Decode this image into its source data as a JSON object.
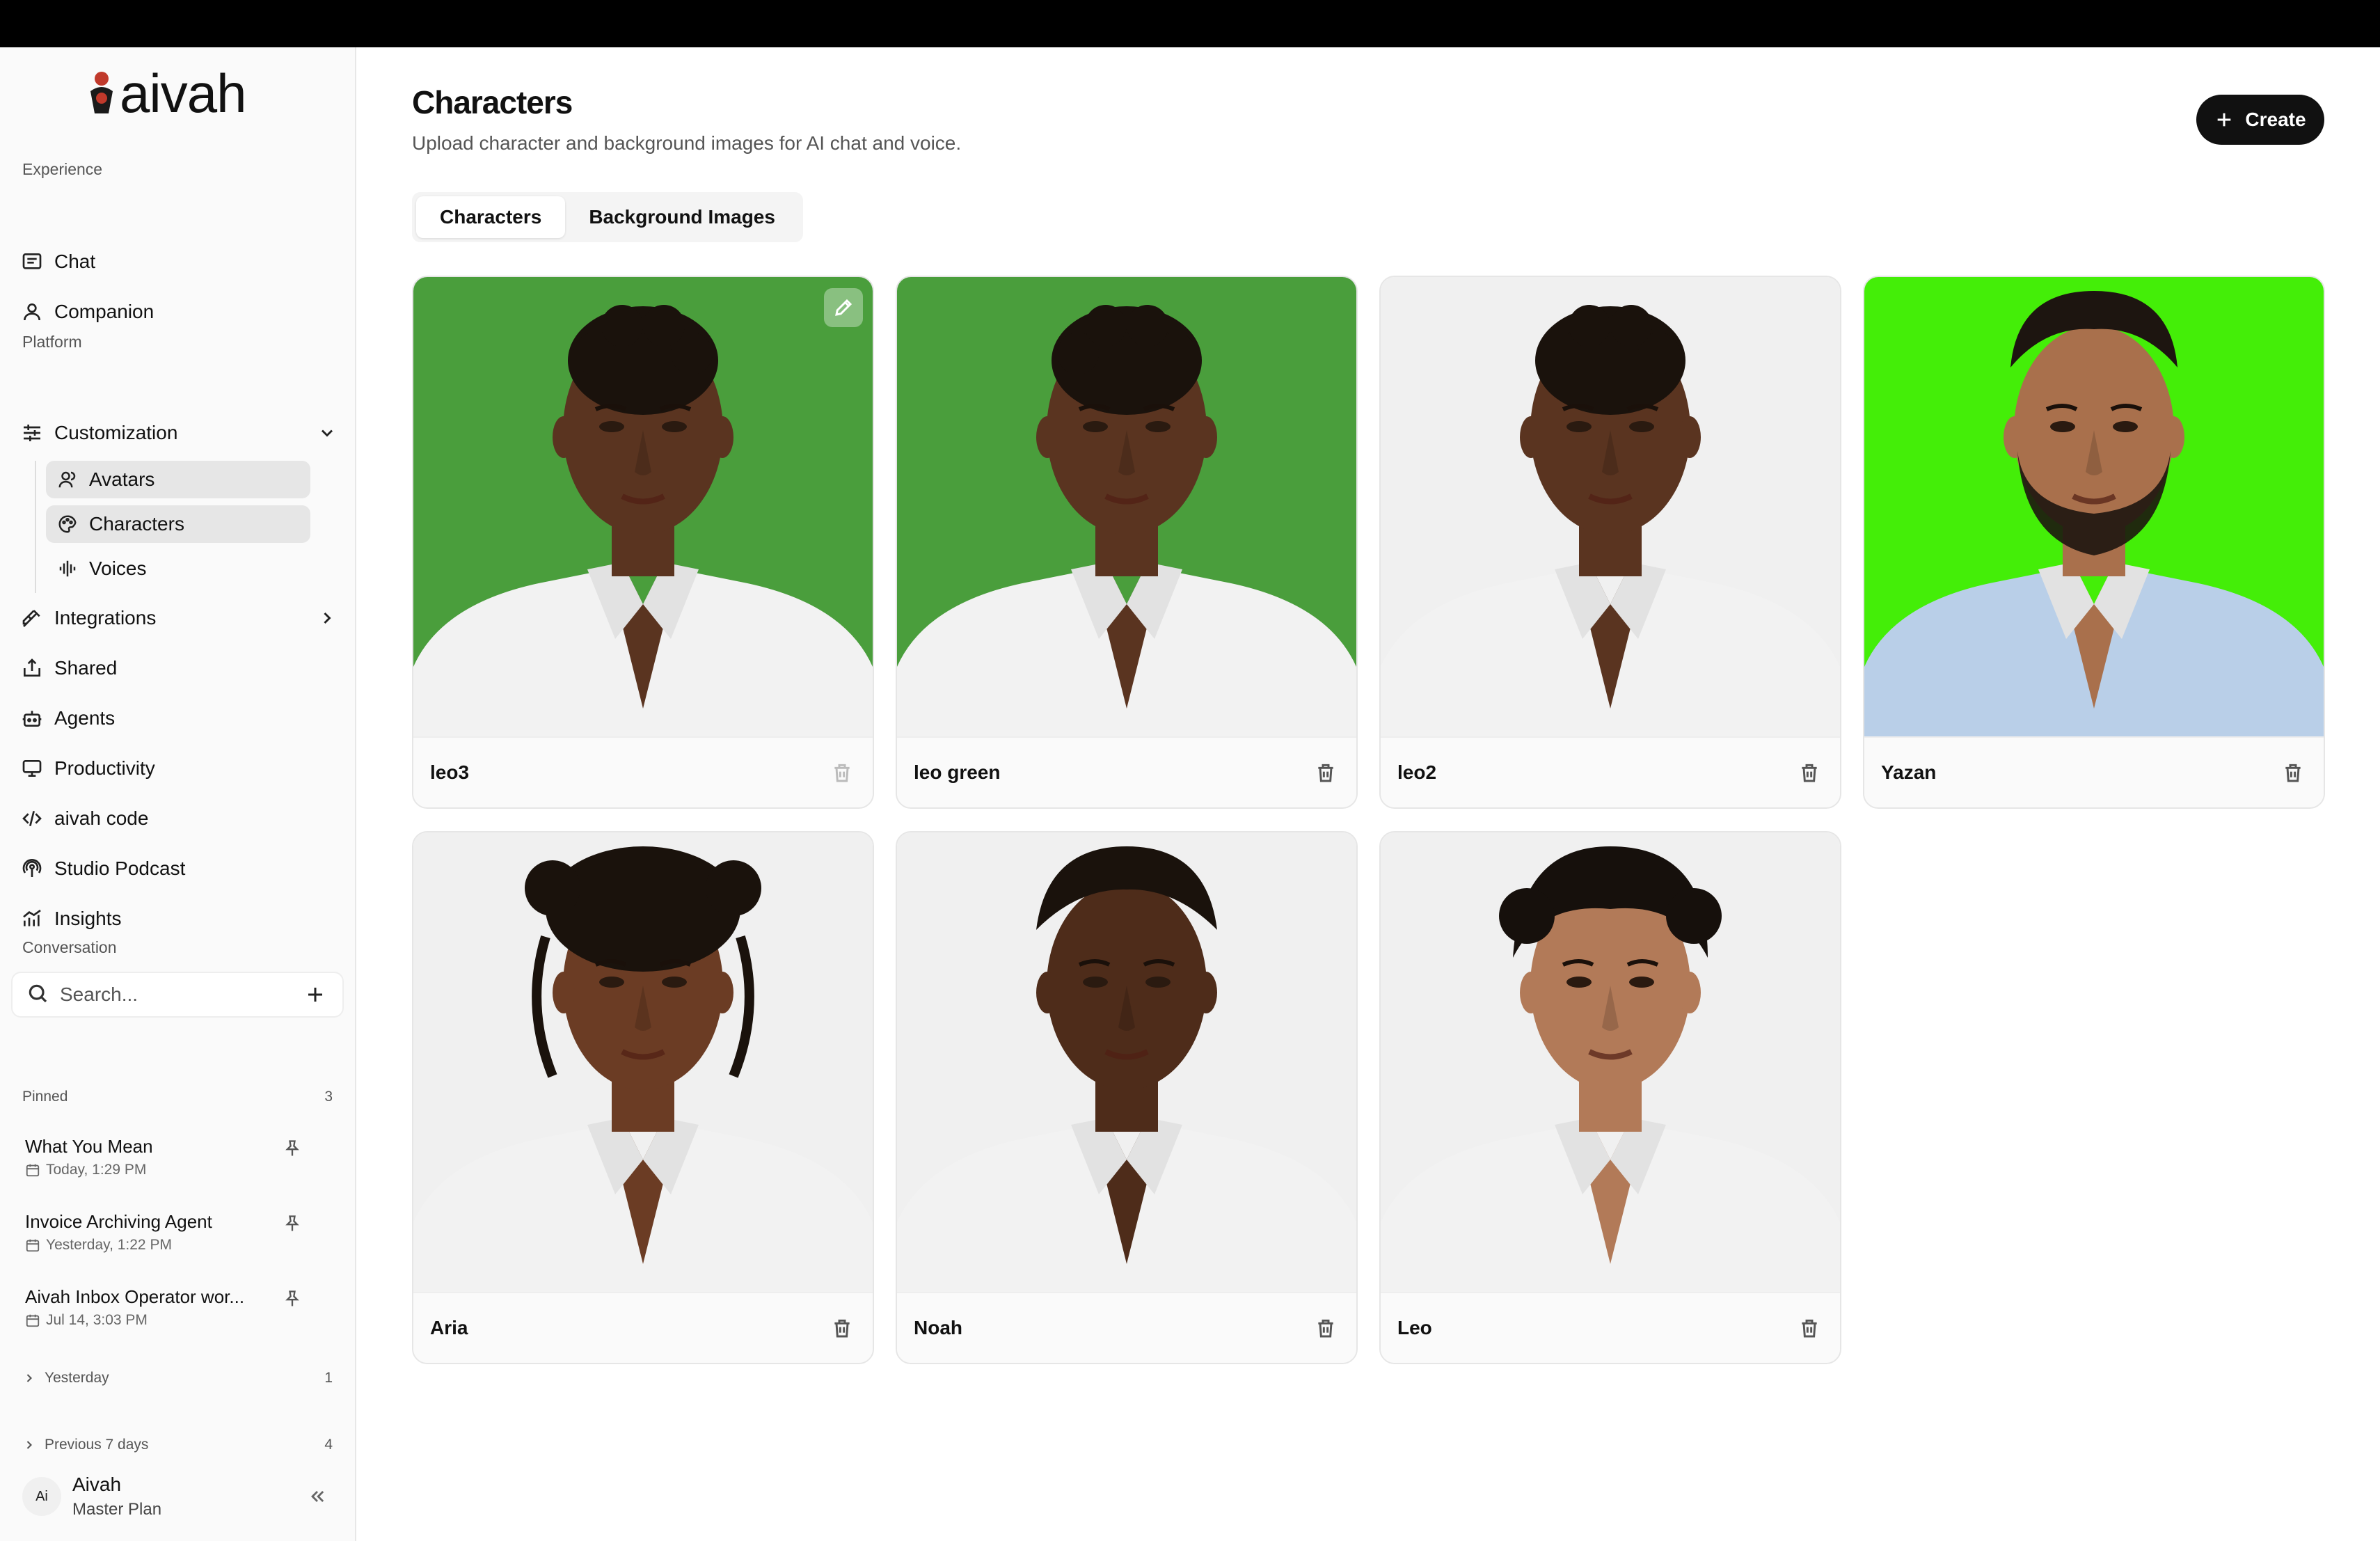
{
  "app": {
    "logo_text": "aivah"
  },
  "sidebar": {
    "experience_label": "Experience",
    "experience_items": [
      {
        "label": "Chat",
        "icon": "chat-icon"
      },
      {
        "label": "Companion",
        "icon": "user-icon"
      }
    ],
    "platform_label": "Platform",
    "customization": {
      "label": "Customization",
      "icon": "sliders-icon",
      "expanded": true
    },
    "customization_sub": [
      {
        "label": "Avatars",
        "icon": "user-icon",
        "active": true
      },
      {
        "label": "Characters",
        "icon": "palette-icon",
        "active": true
      },
      {
        "label": "Voices",
        "icon": "waveform-icon",
        "active": false
      }
    ],
    "platform_items": [
      {
        "label": "Integrations",
        "icon": "plug-icon",
        "has_chevron": true
      },
      {
        "label": "Shared",
        "icon": "share-icon"
      },
      {
        "label": "Agents",
        "icon": "bot-icon"
      },
      {
        "label": "Productivity",
        "icon": "monitor-icon"
      },
      {
        "label": "aivah code",
        "icon": "code-icon"
      },
      {
        "label": "Studio Podcast",
        "icon": "podcast-icon"
      },
      {
        "label": "Insights",
        "icon": "chart-icon"
      }
    ],
    "conversation_label": "Conversation",
    "search_placeholder": "Search...",
    "pinned_label": "Pinned",
    "pinned_count": "3",
    "pinned": [
      {
        "title": "What You Mean",
        "time": "Today, 1:29 PM"
      },
      {
        "title": "Invoice Archiving Agent",
        "time": "Yesterday, 1:22 PM"
      },
      {
        "title": "Aivah Inbox Operator wor...",
        "time": "Jul 14, 3:03 PM"
      }
    ],
    "groups": [
      {
        "label": "Yesterday",
        "count": "1"
      },
      {
        "label": "Previous 7 days",
        "count": "4"
      }
    ],
    "user": {
      "initials": "Ai",
      "name": "Aivah",
      "plan": "Master Plan"
    }
  },
  "main": {
    "title": "Characters",
    "subtitle": "Upload character and background images for AI chat and voice.",
    "create_label": "Create",
    "tabs": [
      {
        "label": "Characters",
        "active": true
      },
      {
        "label": "Background Images",
        "active": false
      }
    ],
    "characters": [
      {
        "name": "leo3",
        "bg": "#4a9e3c",
        "skin": "#5a3420",
        "hair": "#1a120c",
        "shirt": "#f2f2f2",
        "style": "short-curly"
      },
      {
        "name": "leo green",
        "bg": "#4a9e3c",
        "skin": "#5a3420",
        "hair": "#1a120c",
        "shirt": "#f2f2f2",
        "style": "short-curly"
      },
      {
        "name": "leo2",
        "bg": "#f0f0f0",
        "skin": "#5a3420",
        "hair": "#1a120c",
        "shirt": "#f2f2f2",
        "style": "short-curly"
      },
      {
        "name": "Yazan",
        "bg": "#44ee08",
        "skin": "#a9704c",
        "hair": "#1d1510",
        "shirt": "#b9cfe8",
        "style": "beard"
      },
      {
        "name": "Aria",
        "bg": "#f0f0f0",
        "skin": "#6b3c24",
        "hair": "#1a120c",
        "shirt": "#f2f2f2",
        "style": "curly-updo"
      },
      {
        "name": "Noah",
        "bg": "#f0f0f0",
        "skin": "#4e2c1a",
        "hair": "#1a120c",
        "shirt": "#f2f2f2",
        "style": "short"
      },
      {
        "name": "Leo",
        "bg": "#f0f0f0",
        "skin": "#b27a58",
        "hair": "#16100c",
        "shirt": "#f2f2f2",
        "style": "wavy"
      }
    ]
  }
}
